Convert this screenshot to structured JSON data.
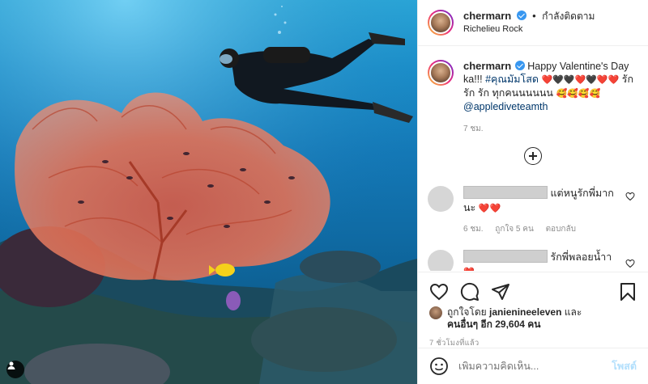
{
  "post": {
    "username": "chermarn",
    "follow_status": "กำลังติดตาม",
    "location": "Richelieu Rock"
  },
  "caption": {
    "username": "chermarn",
    "text_part1": "Happy Valentine's Day ka!!! ",
    "hashtag": "#คุณมัมโสด",
    "emoji_line1": "❤️🖤🖤❤️🖤❤️❤️",
    "text_part2": " รัก รัก รัก ทุกคนนนนนน ",
    "emoji_line2": "🥰🥰🥰🥰",
    "mention": "@applediveteamth",
    "time": "7 ชม."
  },
  "comments": [
    {
      "text": "แต่หนูรักพี่มาก นะ",
      "emoji": "❤️❤️",
      "time": "6 ชม.",
      "likes": "ถูกใจ 5 คน",
      "reply": "ตอบกลับ"
    },
    {
      "text": "รักพี่พลอยน้ำา",
      "emoji": "❤️"
    }
  ],
  "likes": {
    "prefix": "ถูกใจโดย",
    "liker": "janienineeleven",
    "and": "และ",
    "others": "คนอื่นๆ อีก 29,604 คน"
  },
  "post_time": "7 ชั่วโมงที่แล้ว",
  "add_comment": {
    "placeholder": "เพิ่มความคิดเห็น...",
    "post_label": "โพสต์"
  },
  "icons": {
    "like": "heart-icon",
    "comment": "comment-icon",
    "share": "share-icon",
    "save": "bookmark-icon",
    "emoji": "smiley-icon",
    "load_more": "plus-circle-icon",
    "user_tag": "user-tag-icon"
  },
  "colors": {
    "verified": "#3897f0",
    "link": "#00376b",
    "post_button_disabled": "#b2dffc",
    "heart": "#ed4956"
  }
}
